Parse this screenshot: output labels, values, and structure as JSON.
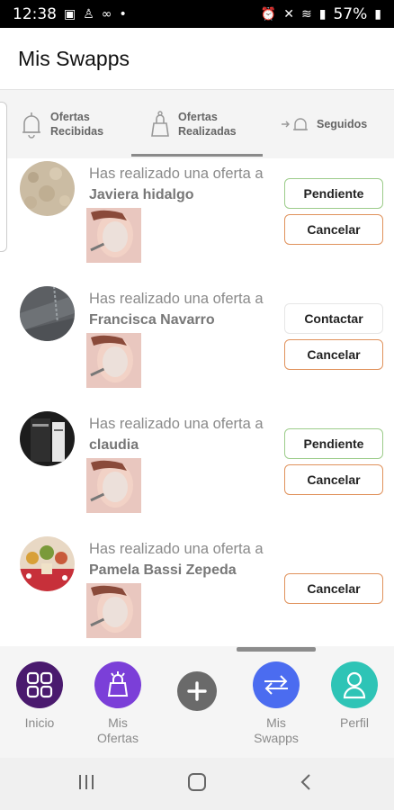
{
  "status_bar": {
    "time": "12:38",
    "battery": "57%"
  },
  "header": {
    "title": "Mis Swapps"
  },
  "tabs": [
    {
      "label": "Ofertas Recibidas",
      "icon": "bell-icon"
    },
    {
      "label": "Ofertas Realizadas",
      "icon": "bag-icon"
    },
    {
      "label": "Seguidos",
      "icon": "follow-bell-icon"
    }
  ],
  "offers": [
    {
      "text": "Has realizado una oferta a",
      "name": "Javiera hidalgo",
      "status": "Pendiente",
      "cancel": "Cancelar"
    },
    {
      "text": "Has realizado una oferta a",
      "name": "Francisca Navarro",
      "status": "Contactar",
      "cancel": "Cancelar"
    },
    {
      "text": "Has realizado una oferta a",
      "name": "claudia",
      "status": "Pendiente",
      "cancel": "Cancelar"
    },
    {
      "text": "Has realizado una oferta a",
      "name": "Pamela Bassi Zepeda",
      "status": "",
      "cancel": "Cancelar"
    }
  ],
  "bottom_nav": [
    {
      "label": "Inicio",
      "icon": "grid-icon",
      "color": "#4a1a6e"
    },
    {
      "label": "Mis Ofertas",
      "icon": "bag-icon",
      "color": "#7b3fd8"
    },
    {
      "label": "",
      "icon": "plus-icon",
      "color": "#6a6a6a"
    },
    {
      "label": "Mis Swapps",
      "icon": "swap-arrows-icon",
      "color": "#4b6cf0"
    },
    {
      "label": "Perfil",
      "icon": "person-icon",
      "color": "#2ec4b6"
    }
  ],
  "colors": {
    "pending_border": "#9ccc8a",
    "cancel_border": "#e0925c"
  }
}
